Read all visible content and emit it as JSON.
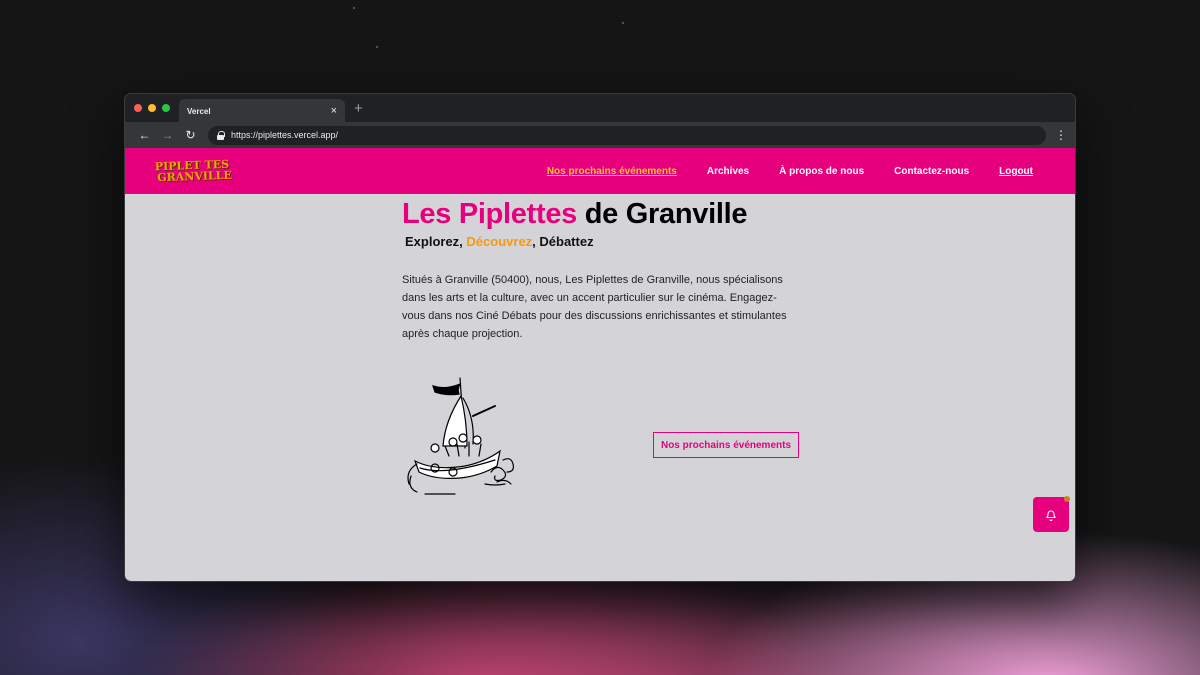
{
  "browser": {
    "tab_title": "Vercel",
    "tab_close": "×",
    "new_tab": "+",
    "back": "←",
    "forward": "→",
    "reload": "↻",
    "url": "https://piplettes.vercel.app/",
    "menu": "⋮"
  },
  "site": {
    "logo_line1": "PIPLET TES",
    "logo_line2": "GRANVILLE",
    "nav": [
      {
        "label": "Nos prochains événements"
      },
      {
        "label": "Archives"
      },
      {
        "label": "À propos de nous"
      },
      {
        "label": "Contactez-nous"
      },
      {
        "label": "Logout"
      }
    ]
  },
  "hero": {
    "title_highlight": "Les Piplettes",
    "title_rest": " de Granville",
    "tag_1": "Explorez, ",
    "tag_2": "Découvrez",
    "tag_3": ", Débattez",
    "description": "Situés à Granville (50400), nous, Les Piplettes de Granville, nous spécialisons dans les arts et la culture, avec un accent particulier sur le cinéma. Engagez-vous dans nos Ciné Débats pour des discussions enrichissantes et stimulantes après chaque projection.",
    "cta": "Nos prochains événements"
  },
  "colors": {
    "brand_pink": "#e6007e",
    "accent_orange": "#f39a12",
    "active_nav": "#f2c230",
    "page_bg": "#d4d4d8"
  },
  "icons": [
    "lock-icon",
    "bell-icon",
    "boat-illustration"
  ]
}
